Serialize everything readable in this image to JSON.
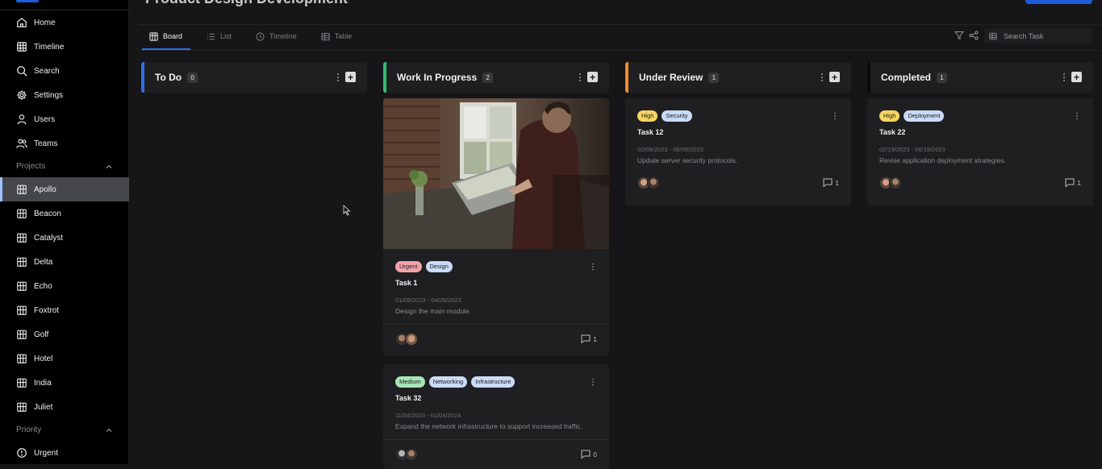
{
  "sidebar": {
    "nav": [
      {
        "label": "Home",
        "icon": "home-icon"
      },
      {
        "label": "Timeline",
        "icon": "timeline-icon"
      },
      {
        "label": "Search",
        "icon": "search-icon"
      },
      {
        "label": "Settings",
        "icon": "gear-icon"
      },
      {
        "label": "Users",
        "icon": "user-icon"
      },
      {
        "label": "Teams",
        "icon": "users-icon"
      }
    ],
    "projects_label": "Projects",
    "projects": [
      {
        "label": "Apollo",
        "active": true
      },
      {
        "label": "Beacon"
      },
      {
        "label": "Catalyst"
      },
      {
        "label": "Delta"
      },
      {
        "label": "Echo"
      },
      {
        "label": "Foxtrot"
      },
      {
        "label": "Golf"
      },
      {
        "label": "Hotel"
      },
      {
        "label": "India"
      },
      {
        "label": "Juliet"
      }
    ],
    "priority_label": "Priority",
    "priority": [
      {
        "label": "Urgent",
        "icon": "alert-circle-icon"
      }
    ]
  },
  "header": {
    "title": "Product Design Development"
  },
  "tabs": [
    {
      "label": "Board",
      "icon": "board-icon",
      "active": true
    },
    {
      "label": "List",
      "icon": "list-icon"
    },
    {
      "label": "Timeline",
      "icon": "clock-icon"
    },
    {
      "label": "Table",
      "icon": "table-icon"
    }
  ],
  "search": {
    "placeholder": "Search Task"
  },
  "colors": {
    "accent": "#1e5bd8",
    "todo": "#2f6fe8",
    "in_progress": "#2fbf71",
    "review": "#f08c2b",
    "completed": "#0a0a0a"
  },
  "columns": [
    {
      "title": "To Do",
      "count": "0"
    },
    {
      "title": "Work In Progress",
      "count": "2"
    },
    {
      "title": "Under Review",
      "count": "1"
    },
    {
      "title": "Completed",
      "count": "1"
    }
  ],
  "cards": {
    "task1": {
      "tags": [
        "Urgent",
        "Design"
      ],
      "title": "Task 1",
      "dates": "01/09/2023 - 04/09/2023",
      "desc": "Design the main module.",
      "comments": "1"
    },
    "task32": {
      "tags": [
        "Medium",
        "Networking",
        "Infrastructure"
      ],
      "title": "Task 32",
      "dates": "11/04/2023 - 01/04/2024",
      "desc": "Expand the network infrastructure to support increased traffic.",
      "comments": "0"
    },
    "task12": {
      "tags": [
        "High",
        "Security"
      ],
      "title": "Task 12",
      "dates": "02/09/2023 - 06/09/2023",
      "desc": "Update server security protocols.",
      "comments": "1"
    },
    "task22": {
      "tags": [
        "High",
        "Deployment"
      ],
      "title": "Task 22",
      "dates": "02/19/2023 - 06/19/2023",
      "desc": "Revise application deployment strategies.",
      "comments": "1"
    }
  }
}
